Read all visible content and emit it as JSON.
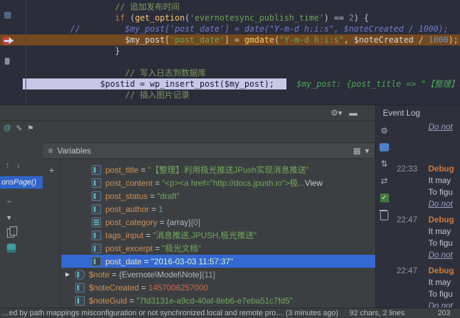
{
  "icons": {
    "gear": "⚙",
    "hide": "▬",
    "menu": "≡",
    "grid": "▦",
    "chev": "▾",
    "plus": "+",
    "up": "↑",
    "down": "↓",
    "minus": "−",
    "expand": "▾",
    "at": "@",
    "edit": "✎",
    "tag": "⚑",
    "swapv": "⇅",
    "swaph": "⇄",
    "check": "✓"
  },
  "editor": {
    "lines": [
      {
        "tokens": [
          {
            "t": "                  ",
            "c": "plain"
          },
          {
            "t": "// 追加发布时间",
            "c": "comment"
          }
        ]
      },
      {
        "tokens": [
          {
            "t": "                  ",
            "c": "plain"
          },
          {
            "t": "if",
            "c": "kw"
          },
          {
            "t": " (",
            "c": "plain"
          },
          {
            "t": "get_option",
            "c": "fn"
          },
          {
            "t": "(",
            "c": "plain"
          },
          {
            "t": "'evernotesync_publish_time'",
            "c": "str"
          },
          {
            "t": ") == ",
            "c": "plain"
          },
          {
            "t": "2",
            "c": "num"
          },
          {
            "t": ") {",
            "c": "plain"
          }
        ]
      },
      {
        "tokens": [
          {
            "t": "         ",
            "c": "plain"
          },
          {
            "t": "//",
            "c": "ccode"
          },
          {
            "t": "         ",
            "c": "ccode"
          },
          {
            "t": "$my_post['post_date'] = date(\"Y-m-d h:i:s\", $noteCreated / 1000);",
            "c": "ccode"
          }
        ]
      },
      {
        "hl": "stmt",
        "tokens": [
          {
            "t": "                    ",
            "c": "plain"
          },
          {
            "t": "$my_post",
            "c": "var"
          },
          {
            "t": "[",
            "c": "plain"
          },
          {
            "t": "'post_date'",
            "c": "str"
          },
          {
            "t": "] = ",
            "c": "plain"
          },
          {
            "t": "gmdate",
            "c": "fn"
          },
          {
            "t": "(",
            "c": "plain"
          },
          {
            "t": "\"Y-m-d h:i:s\"",
            "c": "str"
          },
          {
            "t": ", ",
            "c": "plain"
          },
          {
            "t": "$noteCreated",
            "c": "var"
          },
          {
            "t": " / ",
            "c": "plain"
          },
          {
            "t": "1000",
            "c": "num"
          },
          {
            "t": ");",
            "c": "plain"
          }
        ]
      },
      {
        "tokens": [
          {
            "t": "                  }",
            "c": "plain"
          }
        ]
      },
      {
        "tokens": []
      },
      {
        "tokens": [
          {
            "t": "                    ",
            "c": "plain"
          },
          {
            "t": "// 写入日志到数据库",
            "c": "comment"
          }
        ]
      },
      {
        "hl": "exec",
        "tokens": [
          {
            "t": "               ",
            "c": "exec"
          },
          {
            "t": "$postid = wp_insert_post($my_post);",
            "c": "exec"
          }
        ],
        "hint": "$my_post: {post_title => \"【整理】利"
      },
      {
        "tokens": [
          {
            "t": "                    ",
            "c": "plain"
          },
          {
            "t": "// 插入图片记录",
            "c": "comment"
          }
        ]
      }
    ]
  },
  "debugger": {
    "variables_title": "Variables",
    "frames_selected": "onsPage()",
    "variables": [
      {
        "indent": 2,
        "icon": "field",
        "name": "post_title",
        "value": [
          {
            "t": "\"【整理】利用极光推送JPush实现消息推送\"",
            "c": "str"
          }
        ]
      },
      {
        "indent": 2,
        "icon": "field",
        "name": "post_content",
        "value": [
          {
            "t": "\"<p><a href=\"http://docs.jpush.io\">极",
            "c": "str"
          },
          {
            "t": "... ",
            "c": "dim"
          },
          {
            "t": "View",
            "c": "view"
          }
        ]
      },
      {
        "indent": 2,
        "icon": "field",
        "name": "post_status",
        "value": [
          {
            "t": "\"draft\"",
            "c": "str"
          }
        ]
      },
      {
        "indent": 2,
        "icon": "field",
        "name": "post_author",
        "value": [
          {
            "t": "1",
            "c": "num"
          }
        ]
      },
      {
        "indent": 2,
        "icon": "array",
        "name": "post_category",
        "value": [
          {
            "t": "{array}",
            "c": "meta"
          },
          {
            "t": " [0]",
            "c": "dim"
          }
        ]
      },
      {
        "indent": 2,
        "icon": "field",
        "name": "tags_input",
        "value": [
          {
            "t": "\"消息推送,JPUSH,极光推送\"",
            "c": "str"
          }
        ]
      },
      {
        "indent": 2,
        "icon": "field",
        "name": "post_excerpt",
        "value": [
          {
            "t": "\"极光文档\"",
            "c": "str"
          }
        ]
      },
      {
        "indent": 2,
        "icon": "field",
        "name": "post_date",
        "selected": true,
        "value": [
          {
            "t": "\"2016-03-03 11:57:37\"",
            "c": "str"
          }
        ]
      },
      {
        "indent": 1,
        "arrow": true,
        "icon": "object",
        "name": "$note",
        "value": [
          {
            "t": "{Evernote\\Model\\Note}",
            "c": "meta"
          },
          {
            "t": " [11]",
            "c": "dim"
          }
        ]
      },
      {
        "indent": 1,
        "icon": "field",
        "name": "$noteCreated",
        "value": [
          {
            "t": "1457006257000",
            "c": "numr"
          }
        ]
      },
      {
        "indent": 1,
        "icon": "field",
        "name": "$noteGuid",
        "value": [
          {
            "t": "\"7fd3131e-a9cd-40af-8eb6-e7eba51c7fd5\"",
            "c": "str"
          }
        ]
      }
    ]
  },
  "event_log": {
    "title": "Event Log",
    "partial_line": "Do not",
    "entries": [
      {
        "time": "22:33",
        "lines": [
          {
            "t": "Debug",
            "c": "warn"
          },
          {
            "t": "It may",
            "c": "msg"
          },
          {
            "t": "To figu",
            "c": "msg"
          },
          {
            "t": "Do not",
            "c": "link"
          }
        ]
      },
      {
        "time": "22:47",
        "lines": [
          {
            "t": "Debug",
            "c": "warn"
          },
          {
            "t": "It may",
            "c": "msg"
          },
          {
            "t": "To figu",
            "c": "msg"
          },
          {
            "t": "Do not",
            "c": "link"
          }
        ]
      },
      {
        "time": "22:47",
        "lines": [
          {
            "t": "Debug",
            "c": "warn"
          },
          {
            "t": "It may",
            "c": "msg"
          },
          {
            "t": "To figu",
            "c": "msg"
          },
          {
            "t": "Do not",
            "c": "link"
          }
        ]
      }
    ]
  },
  "status_bar": {
    "message": "…ed by path mappings misconfiguration or not synchronized local and remote pro… (3 minutes ago)",
    "chars_info": "92 chars, 2 lines",
    "position": "203"
  }
}
